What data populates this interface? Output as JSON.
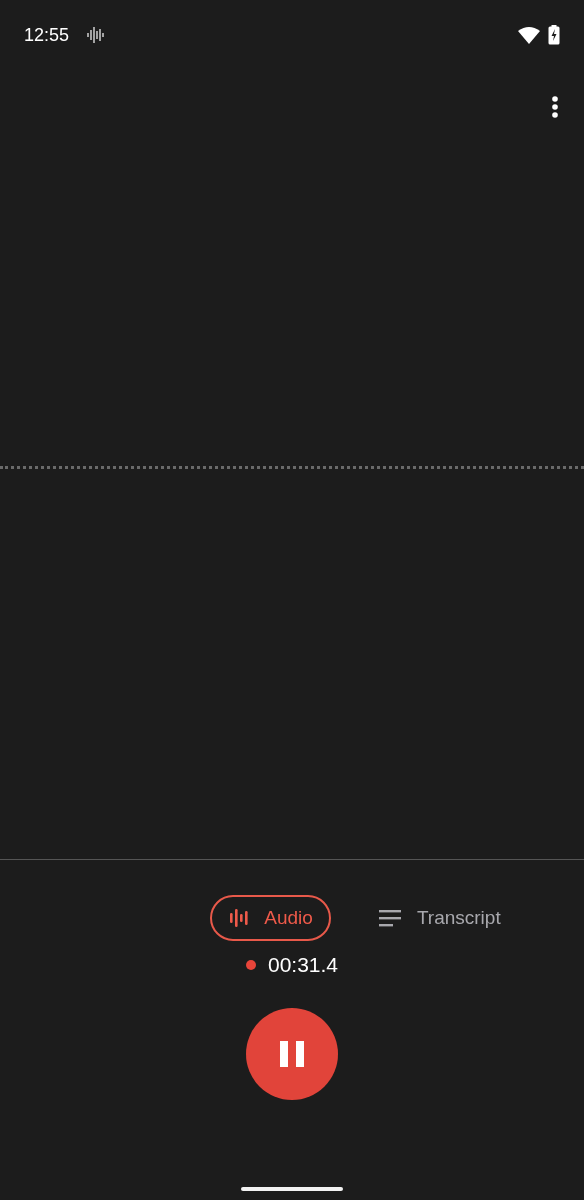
{
  "status_bar": {
    "time": "12:55"
  },
  "tabs": [
    {
      "label": "Audio",
      "kind": "waveform",
      "selected": true
    },
    {
      "label": "Transcript",
      "kind": "lines",
      "selected": false
    }
  ],
  "timer": {
    "text": "00:31.4",
    "recording": true
  }
}
